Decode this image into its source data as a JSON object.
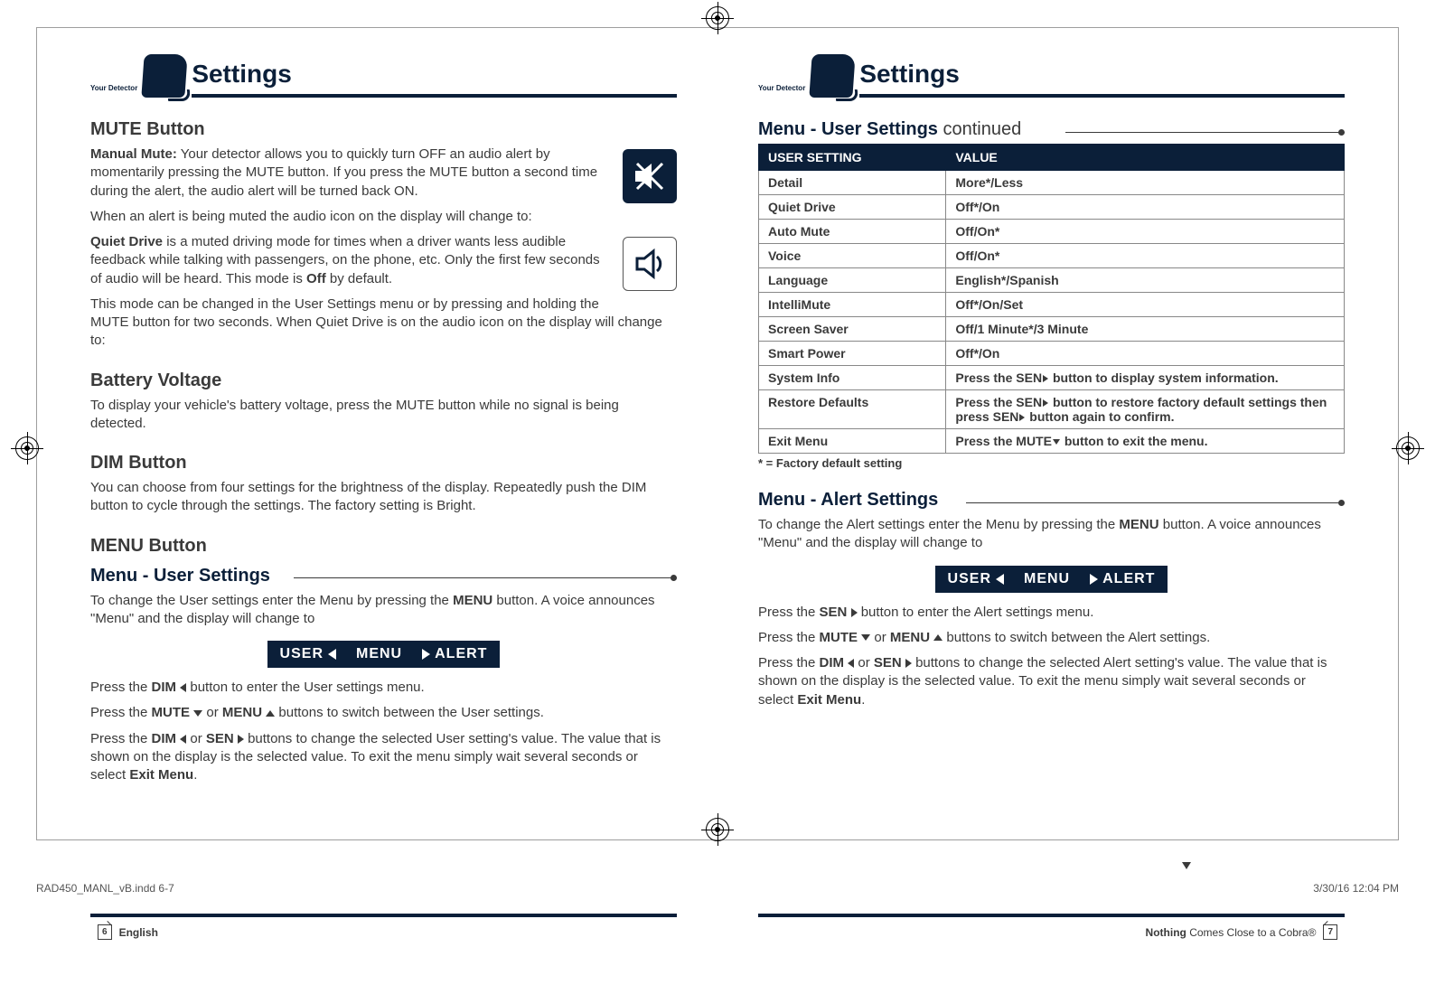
{
  "header": {
    "your_detector": "Your Detector",
    "title_left": "Settings",
    "title_right": "Settings"
  },
  "left": {
    "mute_heading": "MUTE Button",
    "mute_p1_bold": "Manual Mute:",
    "mute_p1_rest": " Your detector allows you to quickly turn OFF an audio alert by momentarily pressing the MUTE button. If you press the MUTE button a second time during the alert, the audio alert will be turned back ON.",
    "mute_p2": "When an alert is being muted the audio icon on the display will change to:",
    "quiet_p1_bold": "Quiet Drive",
    "quiet_p1_rest": " is a muted driving mode for times when a driver wants less audible feedback while talking with passengers, on the phone, etc. Only the first few seconds of audio will be heard. This mode is ",
    "quiet_p1_off": "Off",
    "quiet_p1_tail": " by default.",
    "quiet_p2": "This mode can be changed in the User Settings menu or by pressing and holding the MUTE button for two seconds. When Quiet Drive is on the audio icon on the display will change to:",
    "battery_heading": "Battery Voltage",
    "battery_p": "To display your vehicle's battery voltage, press the MUTE button while no signal is being detected.",
    "dim_heading": "DIM Button",
    "dim_p": "You can choose from four settings for the brightness of the display. Repeatedly push the DIM button to cycle through the settings. The factory setting is Bright.",
    "menu_heading": "MENU Button",
    "menu_sub": "Menu - User Settings",
    "menu_p1a": "To change the User settings enter the Menu by pressing the ",
    "menu_p1b": "MENU",
    "menu_p1c": " button. A voice announces \"Menu\" and the display will change to",
    "lcd_user": "USER",
    "lcd_menu": "MENU",
    "lcd_alert": "ALERT",
    "press_dim_l_a": "Press the ",
    "press_dim_l_b": "DIM",
    "press_dim_l_c": " button to enter the User settings menu.",
    "press_mute_menu_a": "Press the ",
    "press_mute_menu_b": "MUTE",
    "press_mute_menu_c": " or ",
    "press_mute_menu_d": "MENU",
    "press_mute_menu_e": " buttons to switch between the User settings.",
    "press_dimsen_a": "Press the ",
    "press_dimsen_b": "DIM",
    "press_dimsen_c": " or ",
    "press_dimsen_d": "SEN",
    "press_dimsen_e": " buttons to change the selected User setting's value. The value that is shown on the display is the selected value. To exit the menu simply wait several seconds or select ",
    "press_dimsen_f": "Exit Menu",
    "press_dimsen_g": "."
  },
  "right": {
    "cont_heading": "Menu - User Settings",
    "cont_suffix": " continued",
    "th_setting": "USER SETTING",
    "th_value": "VALUE",
    "rows": [
      {
        "k": "Detail",
        "v": "More*/Less"
      },
      {
        "k": "Quiet Drive",
        "v": "Off*/On"
      },
      {
        "k": "Auto Mute",
        "v": "Off/On*"
      },
      {
        "k": "Voice",
        "v": "Off/On*"
      },
      {
        "k": "Language",
        "v": "English*/Spanish"
      },
      {
        "k": "IntelliMute",
        "v": "Off*/On/Set"
      },
      {
        "k": "Screen Saver",
        "v": "Off/1 Minute*/3 Minute"
      },
      {
        "k": "Smart Power",
        "v": "Off*/On"
      }
    ],
    "row_sysinfo_k": "System Info",
    "row_sysinfo_v1": "Press the SEN",
    "row_sysinfo_v2": " button to display system information.",
    "row_restore_k": "Restore Defaults",
    "row_restore_v1": "Press the SEN",
    "row_restore_v2": " button to restore factory default settings then press SEN",
    "row_restore_v3": " button again to confirm.",
    "row_exit_k": "Exit Menu",
    "row_exit_v1": "Press the MUTE",
    "row_exit_v2": " button to exit the menu.",
    "footnote": "* = Factory default setting",
    "alert_heading": "Menu - Alert Settings",
    "alert_p1a": "To change the Alert settings enter the Menu by pressing the ",
    "alert_p1b": "MENU",
    "alert_p1c": " button. A voice announces \"Menu\" and the display will change to",
    "alert_sen_a": "Press the ",
    "alert_sen_b": "SEN",
    "alert_sen_c": " button to enter the Alert settings menu.",
    "alert_mute_menu_a": "Press the ",
    "alert_mute_menu_b": "MUTE",
    "alert_mute_menu_c": " or ",
    "alert_mute_menu_d": "MENU",
    "alert_mute_menu_e": " buttons to switch between the Alert settings.",
    "alert_dimsen_a": "Press the ",
    "alert_dimsen_b": "DIM",
    "alert_dimsen_c": "  or ",
    "alert_dimsen_d": "SEN",
    "alert_dimsen_e": "  buttons to change the selected Alert setting's value. The value that is shown on the display is the selected value. To exit the menu simply wait several seconds or select ",
    "alert_dimsen_f": "Exit Menu",
    "alert_dimsen_g": "."
  },
  "footer": {
    "left_num": "6",
    "left_text": "English",
    "right_text_bold": "Nothing",
    "right_text_rest": " Comes Close to a Cobra®",
    "right_num": "7"
  },
  "slug": {
    "file": "RAD450_MANL_vB.indd   6-7",
    "date": "3/30/16   12:04 PM"
  }
}
